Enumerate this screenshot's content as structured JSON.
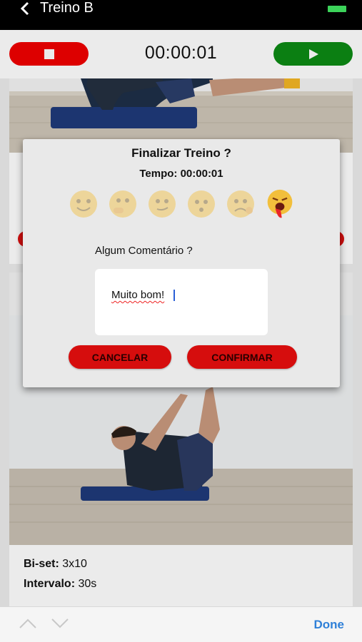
{
  "header": {
    "title": "Treino B"
  },
  "timer": {
    "elapsed": "00:00:01"
  },
  "exercise": {
    "biset_label": "Bi-set:",
    "biset_value": "3x10",
    "interval_label": "Intervalo:",
    "interval_value": "30s"
  },
  "dialog": {
    "title": "Finalizar Treino ?",
    "time_text": "Tempo: 00:00:01",
    "emojis": [
      "happy-face-icon",
      "thinking-face-icon",
      "smirk-face-icon",
      "worried-face-icon",
      "sad-face-icon",
      "exhausted-face-icon"
    ],
    "comment_label": "Algum Comentário ?",
    "comment_value": "Muito bom!",
    "cancel_label": "CANCELAR",
    "confirm_label": "CONFIRMAR"
  },
  "keyboard_toolbar": {
    "done_label": "Done"
  },
  "colors": {
    "stop": "#f00000",
    "play": "#0c8a14",
    "action": "#d60d0d",
    "done": "#2f80d8"
  }
}
